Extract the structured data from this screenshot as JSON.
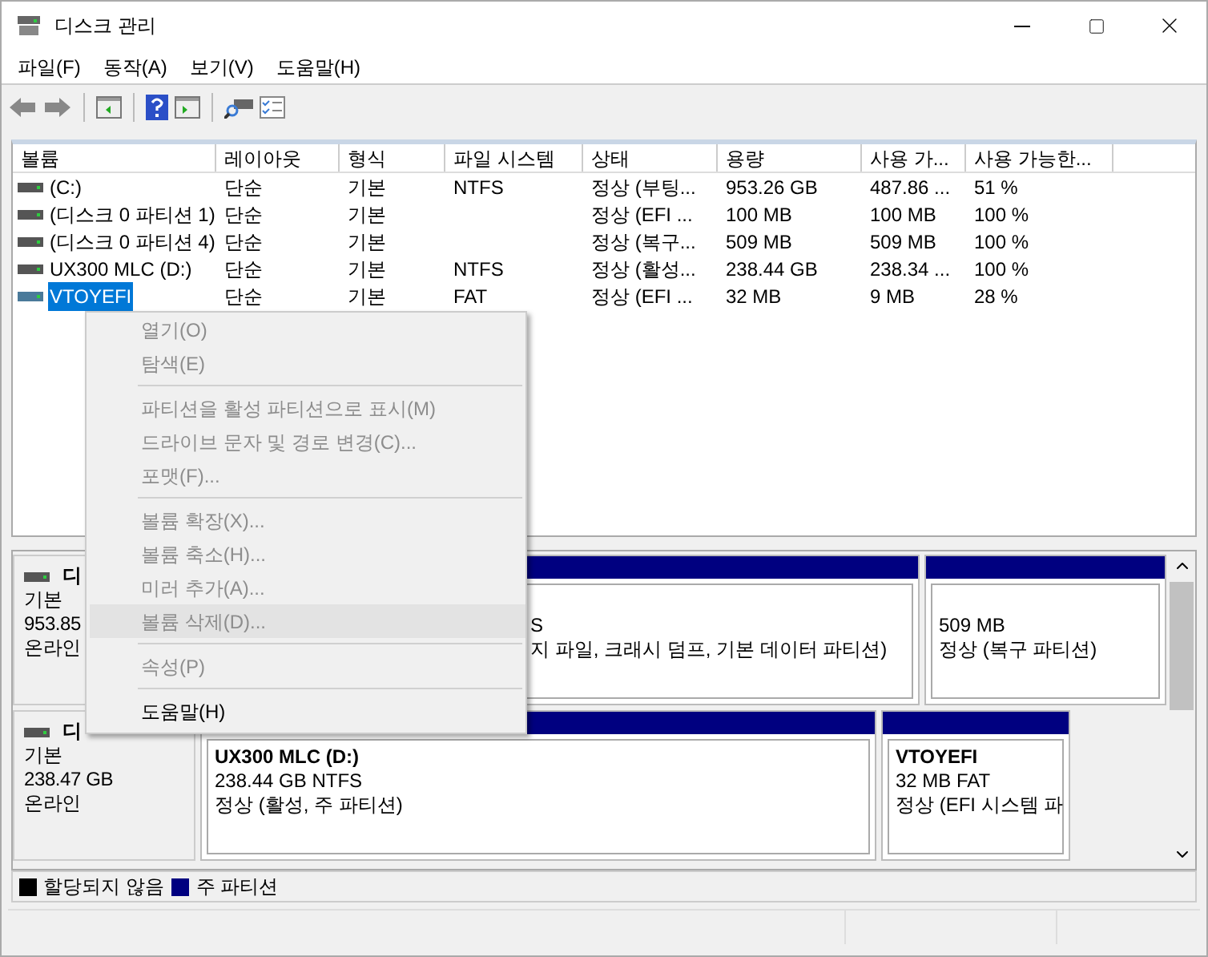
{
  "window": {
    "title": "디스크 관리"
  },
  "menu": [
    "파일(F)",
    "동작(A)",
    "보기(V)",
    "도움말(H)"
  ],
  "volumes": {
    "columns": [
      "볼륨",
      "레이아웃",
      "형식",
      "파일 시스템",
      "상태",
      "용량",
      "사용 가...",
      "사용 가능한..."
    ],
    "rows": [
      {
        "selected": false,
        "cells": [
          "(C:)",
          "단순",
          "기본",
          "NTFS",
          "정상 (부팅...",
          "953.26 GB",
          "487.86 ...",
          "51 %"
        ]
      },
      {
        "selected": false,
        "cells": [
          "(디스크 0 파티션 1)",
          "단순",
          "기본",
          "",
          "정상 (EFI ...",
          "100 MB",
          "100 MB",
          "100 %"
        ]
      },
      {
        "selected": false,
        "cells": [
          "(디스크 0 파티션 4)",
          "단순",
          "기본",
          "",
          "정상 (복구...",
          "509 MB",
          "509 MB",
          "100 %"
        ]
      },
      {
        "selected": false,
        "cells": [
          "UX300 MLC (D:)",
          "단순",
          "기본",
          "NTFS",
          "정상 (활성...",
          "238.44 GB",
          "238.34 ...",
          "100 %"
        ]
      },
      {
        "selected": true,
        "cells": [
          "VTOYEFI",
          "단순",
          "기본",
          "FAT",
          "정상 (EFI ...",
          "32 MB",
          "9 MB",
          "28 %"
        ]
      }
    ]
  },
  "context_menu": {
    "groups": [
      [
        {
          "label": "열기(O)",
          "disabled": true,
          "highlighted": false
        },
        {
          "label": "탐색(E)",
          "disabled": true,
          "highlighted": false
        }
      ],
      [
        {
          "label": "파티션을 활성 파티션으로 표시(M)",
          "disabled": true,
          "highlighted": false
        },
        {
          "label": "드라이브 문자 및 경로 변경(C)...",
          "disabled": true,
          "highlighted": false
        },
        {
          "label": "포맷(F)...",
          "disabled": true,
          "highlighted": false
        }
      ],
      [
        {
          "label": "볼륨 확장(X)...",
          "disabled": true,
          "highlighted": false
        },
        {
          "label": "볼륨 축소(H)...",
          "disabled": true,
          "highlighted": false
        },
        {
          "label": "미러 추가(A)...",
          "disabled": true,
          "highlighted": false
        },
        {
          "label": "볼륨 삭제(D)...",
          "disabled": true,
          "highlighted": true
        }
      ],
      [
        {
          "label": "속성(P)",
          "disabled": true,
          "highlighted": false
        }
      ],
      [
        {
          "label": "도움말(H)",
          "disabled": false,
          "highlighted": false
        }
      ]
    ]
  },
  "disks": [
    {
      "label": "디",
      "type": "기본",
      "size": "953.85",
      "status": "온라인",
      "partitions": [
        {
          "detail": "S",
          "status": "지 파일, 크래시 덤프, 기본 데이터 파티션)"
        },
        {
          "detail": "509 MB",
          "status": "정상 (복구 파티션)"
        }
      ]
    },
    {
      "label": "디",
      "type": "기본",
      "size": "238.47 GB",
      "status": "온라인",
      "partitions": [
        {
          "name": "UX300 MLC  (D:)",
          "detail": "238.44 GB NTFS",
          "status": "정상 (활성, 주 파티션)"
        },
        {
          "name": "VTOYEFI",
          "detail": "32 MB FAT",
          "status": "정상 (EFI 시스템 파"
        }
      ]
    }
  ],
  "legend": [
    {
      "label": "할당되지 않음",
      "color": "#000000"
    },
    {
      "label": "주 파티션",
      "color": "#000080"
    }
  ]
}
